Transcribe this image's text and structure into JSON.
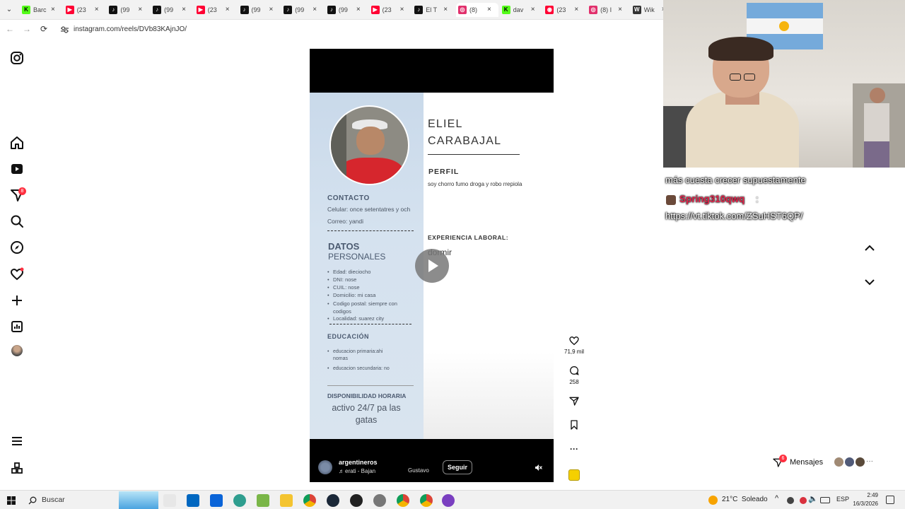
{
  "browser": {
    "tabs": [
      {
        "title": "Barc",
        "fav": "K",
        "color": "#53fc18",
        "tcol": "#000"
      },
      {
        "title": "(23",
        "fav": "▶",
        "color": "#ff0033",
        "tcol": "#fff"
      },
      {
        "title": "(99",
        "fav": "♪",
        "color": "#111111",
        "tcol": "#fff"
      },
      {
        "title": "(99",
        "fav": "♪",
        "color": "#111111",
        "tcol": "#fff"
      },
      {
        "title": "(23",
        "fav": "▶",
        "color": "#ff0033",
        "tcol": "#fff"
      },
      {
        "title": "(99",
        "fav": "♪",
        "color": "#111111",
        "tcol": "#fff"
      },
      {
        "title": "(99",
        "fav": "♪",
        "color": "#111111",
        "tcol": "#fff"
      },
      {
        "title": "(99",
        "fav": "♪",
        "color": "#111111",
        "tcol": "#fff"
      },
      {
        "title": "(23",
        "fav": "▶",
        "color": "#ff0033",
        "tcol": "#fff"
      },
      {
        "title": "El T",
        "fav": "♪",
        "color": "#111111",
        "tcol": "#fff"
      },
      {
        "title": "(8)",
        "fav": "◎",
        "color": "#e1306c",
        "tcol": "#fff"
      },
      {
        "title": "dav",
        "fav": "K",
        "color": "#53fc18",
        "tcol": "#000"
      },
      {
        "title": "(23",
        "fav": "◉",
        "color": "#ff0033",
        "tcol": "#fff"
      },
      {
        "title": "(8) I",
        "fav": "◎",
        "color": "#e1306c",
        "tcol": "#fff"
      },
      {
        "title": "Wik",
        "fav": "W",
        "color": "#333333",
        "tcol": "#fff"
      }
    ],
    "active_tab": 10,
    "close_glyph": "×",
    "url": "instagram.com/reels/DVb83KAjnJO/"
  },
  "reel": {
    "cv": {
      "name_line1": "ELIEL",
      "name_line2": "CARABAJAL",
      "perfil_heading": "PERFIL",
      "perfil_text": "soy chorro fumo droga y robo rrepiola",
      "contacto_heading": "CONTACTO",
      "celular": "Celular: once setentatres y och",
      "correo": "Correo: yandi",
      "datos_heading_1": "DATOS",
      "datos_heading_2": "PERSONALES",
      "datos": [
        "Edad: dieciocho",
        "DNI: nose",
        "CUIL: nose",
        "Domicilio: mi casa",
        "Codigo postal: siempre con codigos",
        "Localidad: suarez city"
      ],
      "educacion_heading": "EDUCACIÓN",
      "educacion_1": "educacion primaria:ahi nomas",
      "educacion_2": "educacion secundaria: no",
      "disponibilidad_heading": "DISPONIBILIDAD HORARIA",
      "disponibilidad_text": "activo 24/7 pa las gatas",
      "experiencia_heading": "EXPERIENCIA LABORAL:",
      "experiencia_text": "dormir"
    },
    "author": "argentineros",
    "audio": "erati - Bajan",
    "tagged": "Gustavo",
    "follow_label": "Seguir",
    "likes": "71,9 mil",
    "comments": "258"
  },
  "overlay": {
    "chat_line_1": "más cuesta crecer supuestamente",
    "chat_user": "Spring310qwq",
    "chat_link": "https://vt.tiktok.com/ZSuHST6QP/",
    "messages_label": "Mensajes",
    "messages_badge": "6",
    "notif_badge": "8",
    "more_glyph": "···"
  },
  "taskbar": {
    "search_placeholder": "Buscar",
    "weather": "21°C  Soleado",
    "lang": "ESP",
    "time": "2:49",
    "date": "16/3/2026"
  }
}
